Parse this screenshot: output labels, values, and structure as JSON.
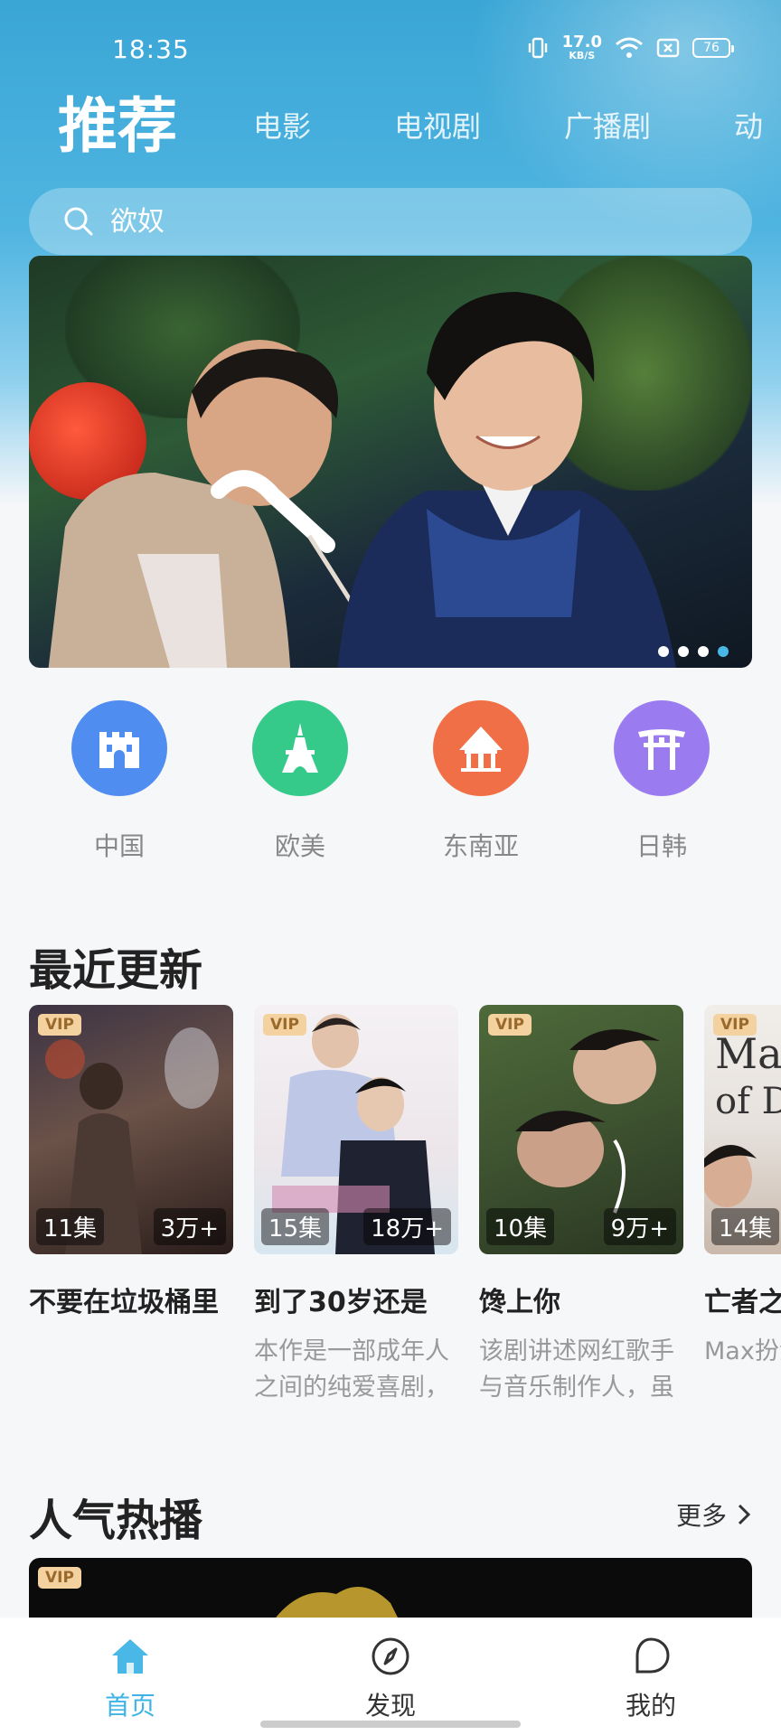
{
  "status_bar": {
    "time": "18:35",
    "net_speed_value": "17.0",
    "net_speed_unit": "KB/S",
    "battery": "76"
  },
  "top_tabs": [
    {
      "label": "推荐",
      "active": true
    },
    {
      "label": "电影",
      "active": false
    },
    {
      "label": "电视剧",
      "active": false
    },
    {
      "label": "广播剧",
      "active": false
    },
    {
      "label": "动",
      "active": false
    }
  ],
  "search": {
    "placeholder": "欲奴"
  },
  "banner": {
    "slide_count": 4,
    "active_slide": 4
  },
  "regions": [
    {
      "label": "中国",
      "icon": "great-wall-icon",
      "color": "#4f8ef0"
    },
    {
      "label": "欧美",
      "icon": "eiffel-tower-icon",
      "color": "#35c98a"
    },
    {
      "label": "东南亚",
      "icon": "temple-icon",
      "color": "#f06f46"
    },
    {
      "label": "日韩",
      "icon": "torii-gate-icon",
      "color": "#9b7cf0"
    }
  ],
  "recent": {
    "title": "最近更新",
    "items": [
      {
        "title": "不要在垃圾桶里",
        "vip": "VIP",
        "episodes": "11集",
        "views": "3万+",
        "desc": ""
      },
      {
        "title": "到了30岁还是",
        "vip": "VIP",
        "episodes": "15集",
        "views": "18万+",
        "desc": "本作是一部成年人之间的纯爱喜剧，"
      },
      {
        "title": "馋上你",
        "vip": "VIP",
        "episodes": "10集",
        "views": "9万+",
        "desc": "该剧讲述网红歌手与音乐制作人，虽"
      },
      {
        "title": "亡者之",
        "vip": "VIP",
        "episodes": "14集",
        "views": "",
        "desc": "Max扮演师，Tu"
      }
    ]
  },
  "hot": {
    "title": "人气热播",
    "more": "更多",
    "vip": "VIP"
  },
  "bottom_nav": [
    {
      "label": "首页",
      "icon": "home-icon",
      "active": true
    },
    {
      "label": "发现",
      "icon": "compass-icon",
      "active": false
    },
    {
      "label": "我的",
      "icon": "profile-icon",
      "active": false
    }
  ],
  "colors": {
    "accent": "#3fb3e6",
    "header": "#3aa6d6",
    "vip_bg": "#f3d2a0"
  }
}
